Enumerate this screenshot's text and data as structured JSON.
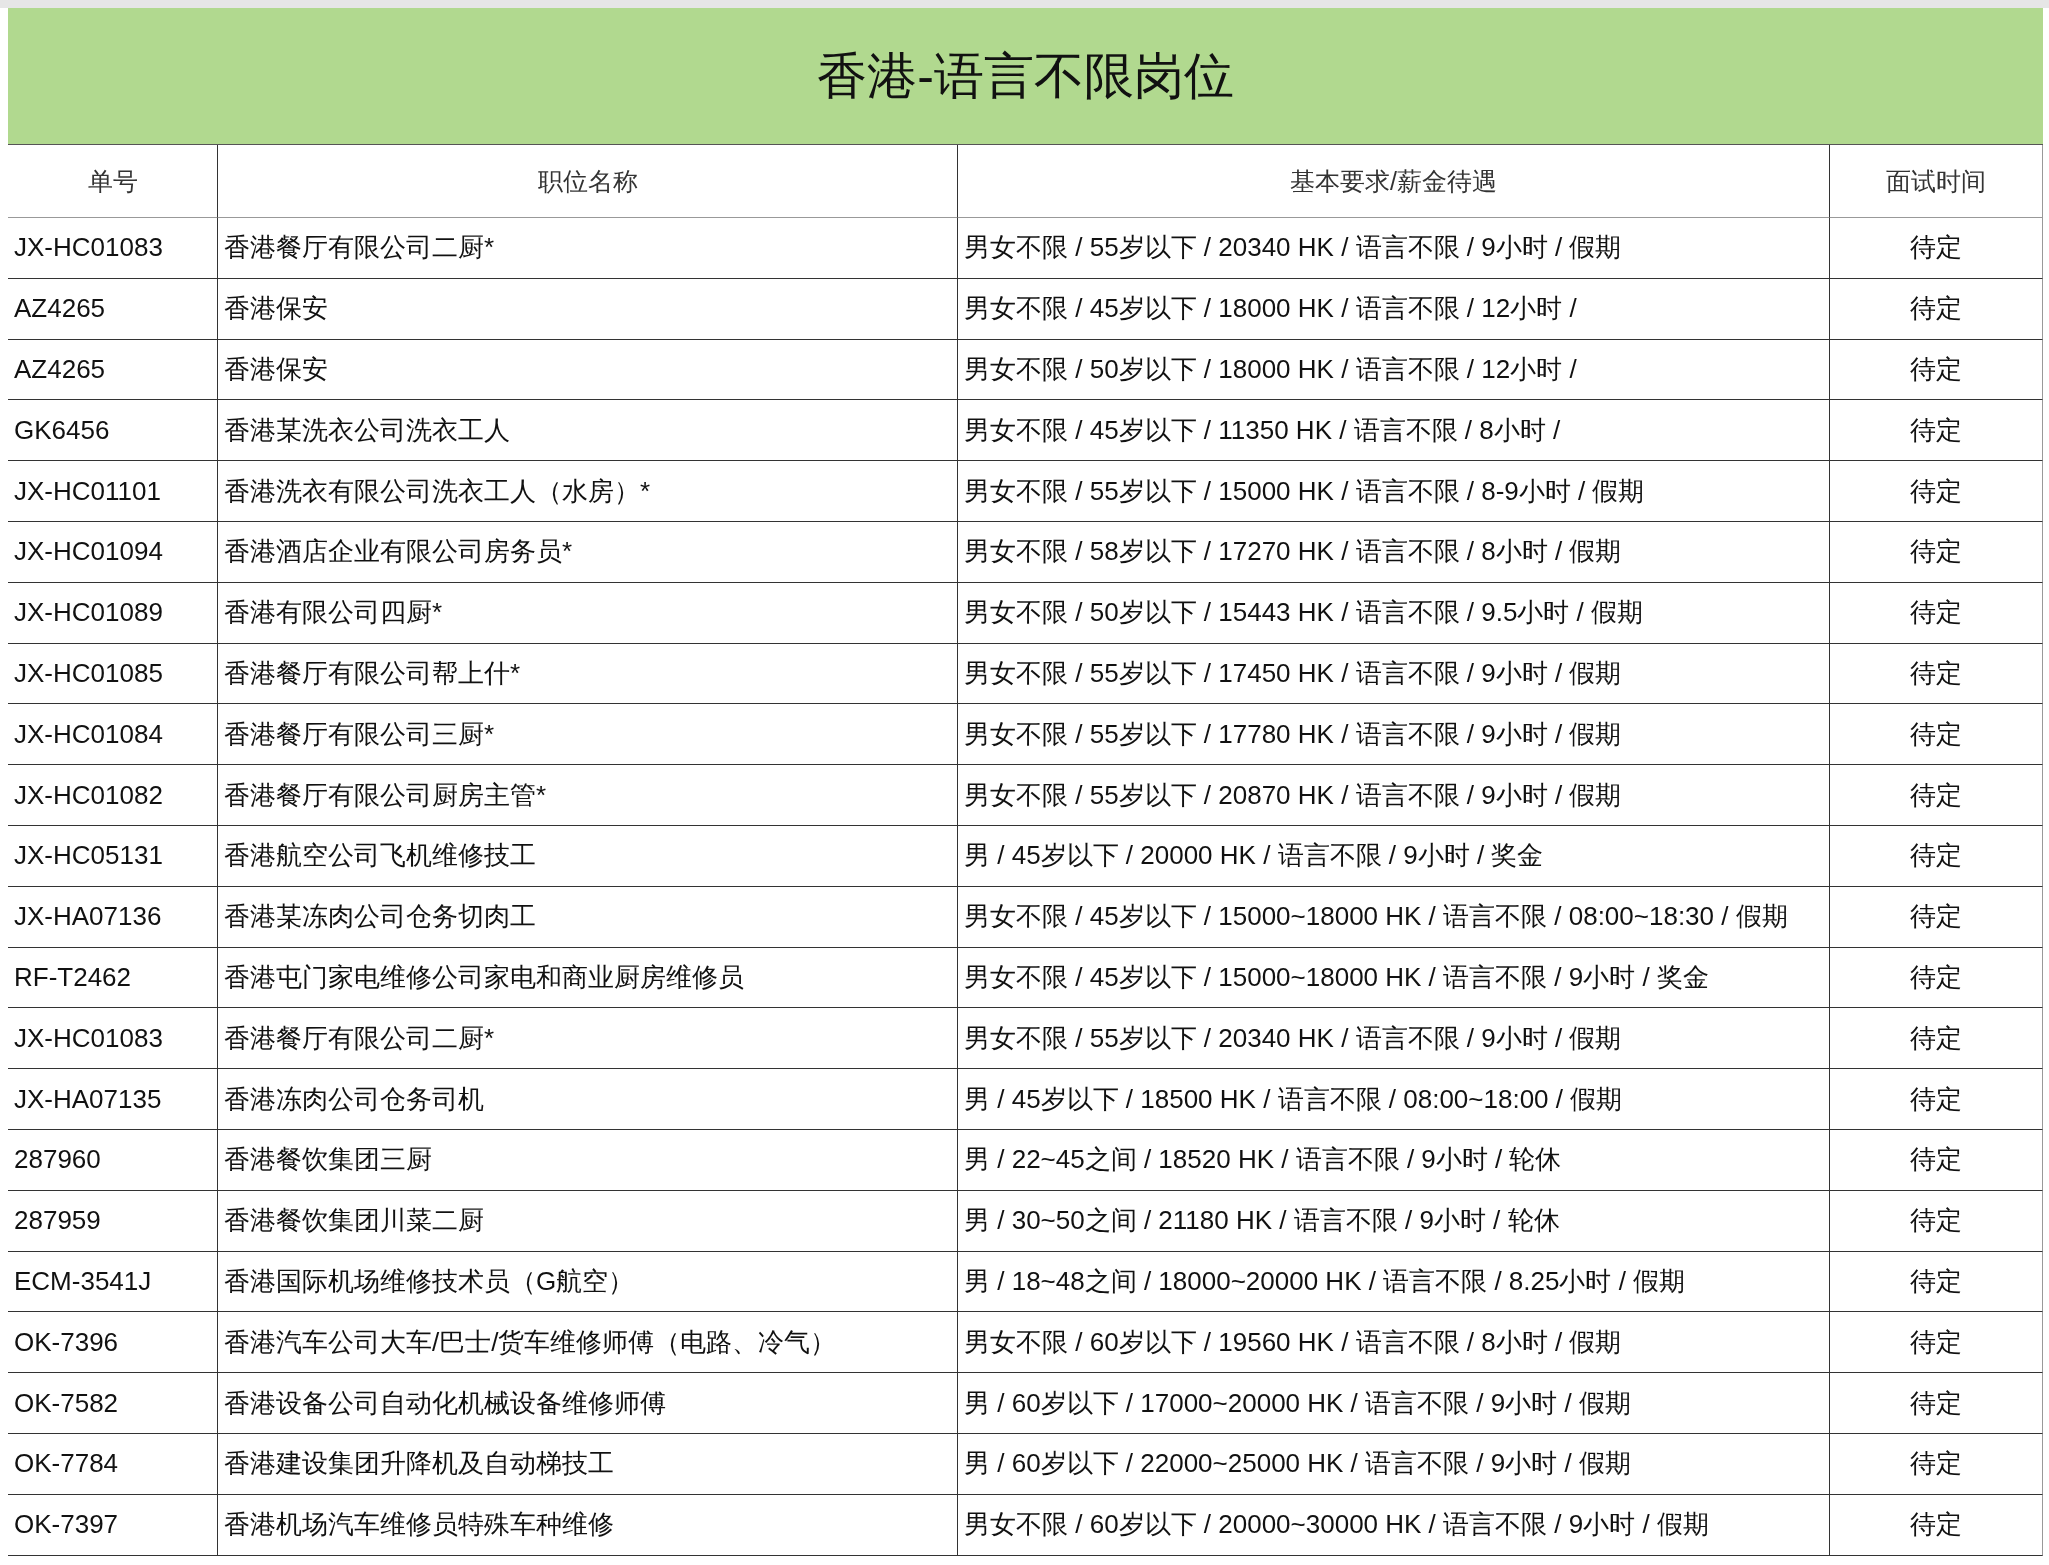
{
  "sheet": {
    "title": "香港-语言不限岗位",
    "columns": [
      "单号",
      "职位名称",
      "基本要求/薪金待遇",
      "面试时间"
    ],
    "rows": [
      {
        "order_no": "JX-HC01083",
        "position": "香港餐厅有限公司二厨*",
        "requirements": "男女不限 / 55岁以下 / 20340 HK / 语言不限 / 9小时 / 假期",
        "interview": "待定"
      },
      {
        "order_no": "AZ4265",
        "position": "香港保安",
        "requirements": "男女不限 / 45岁以下 / 18000 HK / 语言不限 / 12小时 /",
        "interview": "待定"
      },
      {
        "order_no": "AZ4265",
        "position": "香港保安",
        "requirements": "男女不限 / 50岁以下 / 18000 HK / 语言不限 / 12小时 /",
        "interview": "待定"
      },
      {
        "order_no": "GK6456",
        "position": "香港某洗衣公司洗衣工人",
        "requirements": "男女不限 / 45岁以下 / 11350 HK / 语言不限 / 8小时 /",
        "interview": "待定"
      },
      {
        "order_no": "JX-HC01101",
        "position": "香港洗衣有限公司洗衣工人（水房）*",
        "requirements": "男女不限 / 55岁以下 / 15000 HK / 语言不限 / 8-9小时 / 假期",
        "interview": "待定"
      },
      {
        "order_no": "JX-HC01094",
        "position": "香港酒店企业有限公司房务员*",
        "requirements": "男女不限 / 58岁以下 / 17270 HK / 语言不限 / 8小时 / 假期",
        "interview": "待定"
      },
      {
        "order_no": "JX-HC01089",
        "position": "香港有限公司四厨*",
        "requirements": "男女不限 / 50岁以下 / 15443 HK / 语言不限 / 9.5小时 / 假期",
        "interview": "待定"
      },
      {
        "order_no": "JX-HC01085",
        "position": "香港餐厅有限公司帮上什*",
        "requirements": "男女不限 / 55岁以下 / 17450 HK / 语言不限 / 9小时 / 假期",
        "interview": "待定"
      },
      {
        "order_no": "JX-HC01084",
        "position": "香港餐厅有限公司三厨*",
        "requirements": "男女不限 / 55岁以下 / 17780 HK / 语言不限 / 9小时 / 假期",
        "interview": "待定"
      },
      {
        "order_no": "JX-HC01082",
        "position": "香港餐厅有限公司厨房主管*",
        "requirements": "男女不限 / 55岁以下 / 20870 HK / 语言不限 / 9小时 / 假期",
        "interview": "待定"
      },
      {
        "order_no": "JX-HC05131",
        "position": "香港航空公司飞机维修技工",
        "requirements": "男 / 45岁以下 / 20000 HK / 语言不限 / 9小时 / 奖金",
        "interview": "待定"
      },
      {
        "order_no": "JX-HA07136",
        "position": "香港某冻肉公司仓务切肉工",
        "requirements": "男女不限 / 45岁以下 / 15000~18000 HK / 语言不限 / 08:00~18:30 / 假期",
        "interview": "待定"
      },
      {
        "order_no": "RF-T2462",
        "position": "香港屯门家电维修公司家电和商业厨房维修员",
        "requirements": "男女不限 / 45岁以下 / 15000~18000 HK / 语言不限 / 9小时 / 奖金",
        "interview": "待定"
      },
      {
        "order_no": "JX-HC01083",
        "position": "香港餐厅有限公司二厨*",
        "requirements": "男女不限 / 55岁以下 / 20340 HK / 语言不限 / 9小时 / 假期",
        "interview": "待定"
      },
      {
        "order_no": "JX-HA07135",
        "position": "香港冻肉公司仓务司机",
        "requirements": "男 / 45岁以下 / 18500 HK / 语言不限 / 08:00~18:00 / 假期",
        "interview": "待定"
      },
      {
        "order_no": "287960",
        "position": "香港餐饮集团三厨",
        "requirements": "男 / 22~45之间 / 18520 HK / 语言不限 / 9小时 / 轮休",
        "interview": "待定"
      },
      {
        "order_no": "287959",
        "position": "香港餐饮集团川菜二厨",
        "requirements": "男 / 30~50之间 / 21180 HK / 语言不限 / 9小时 / 轮休",
        "interview": "待定"
      },
      {
        "order_no": "ECM-3541J",
        "position": "香港国际机场维修技术员（G航空）",
        "requirements": "男 / 18~48之间 / 18000~20000 HK / 语言不限 / 8.25小时 / 假期",
        "interview": "待定"
      },
      {
        "order_no": "OK-7396",
        "position": "香港汽车公司大车/巴士/货车维修师傅（电路、冷气）",
        "requirements": "男女不限 / 60岁以下 / 19560 HK / 语言不限 / 8小时 / 假期",
        "interview": "待定"
      },
      {
        "order_no": "OK-7582",
        "position": "香港设备公司自动化机械设备维修师傅",
        "requirements": "男 / 60岁以下 / 17000~20000 HK / 语言不限 / 9小时 / 假期",
        "interview": "待定"
      },
      {
        "order_no": "OK-7784",
        "position": "香港建设集团升降机及自动梯技工",
        "requirements": "男 / 60岁以下 / 22000~25000 HK / 语言不限 / 9小时 / 假期",
        "interview": "待定"
      },
      {
        "order_no": "OK-7397",
        "position": "香港机场汽车维修员特殊车种维修",
        "requirements": "男女不限 / 60岁以下 / 20000~30000 HK / 语言不限 / 9小时 / 假期",
        "interview": "待定"
      }
    ]
  }
}
